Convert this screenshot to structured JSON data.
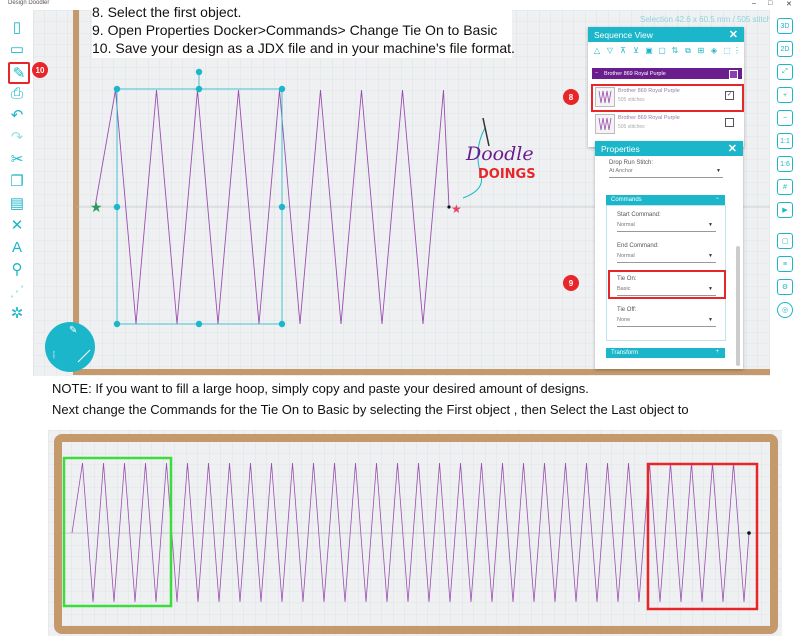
{
  "app": {
    "title": "Design Doodler"
  },
  "instructions": [
    "8. Select the first object.",
    "9. Open Properties Docker>Commands> Change Tie On to Basic",
    "10. Save your design as a JDX file and in your machine's file format."
  ],
  "selection_info": "Selection 42.6 x 60.5 mm / 505 stitches",
  "logo": {
    "line1": "Doodle",
    "line2": "DOINGS"
  },
  "sequence_view": {
    "title": "Sequence View",
    "color_name": "Brother 869 Royal Purple",
    "objects": [
      {
        "name": "Brother 869 Royal Purple",
        "stitches": "505 stitches",
        "checked": "✓"
      },
      {
        "name": "Brother 869 Royal Purple",
        "stitches": "505 stitches",
        "checked": ""
      }
    ]
  },
  "properties": {
    "title": "Properties",
    "drop_run_label": "Drop Run Stitch:",
    "drop_run_value": "At Anchor",
    "commands_label": "Commands",
    "start_label": "Start Command:",
    "start_value": "Normal",
    "end_label": "End Command:",
    "end_value": "Normal",
    "tie_on_label": "Tie On:",
    "tie_on_value": "Basic",
    "tie_off_label": "Tie Off:",
    "tie_off_value": "None",
    "transform_label": "Transform"
  },
  "badges": {
    "b8": "8",
    "b9": "9",
    "b10": "10"
  },
  "notes": [
    "NOTE: If you want to fill a large hoop, simply copy and paste your desired amount of designs.",
    "Next change the Commands for the Tie On to Basic by selecting the First object , then  Select the Last  object to"
  ],
  "colors": {
    "accent": "#1bb6c9",
    "stitch": "#9a4fb0",
    "hoop": "#c49a6c",
    "highlight": "#e8262a",
    "first_object": "#3ddc3d"
  }
}
